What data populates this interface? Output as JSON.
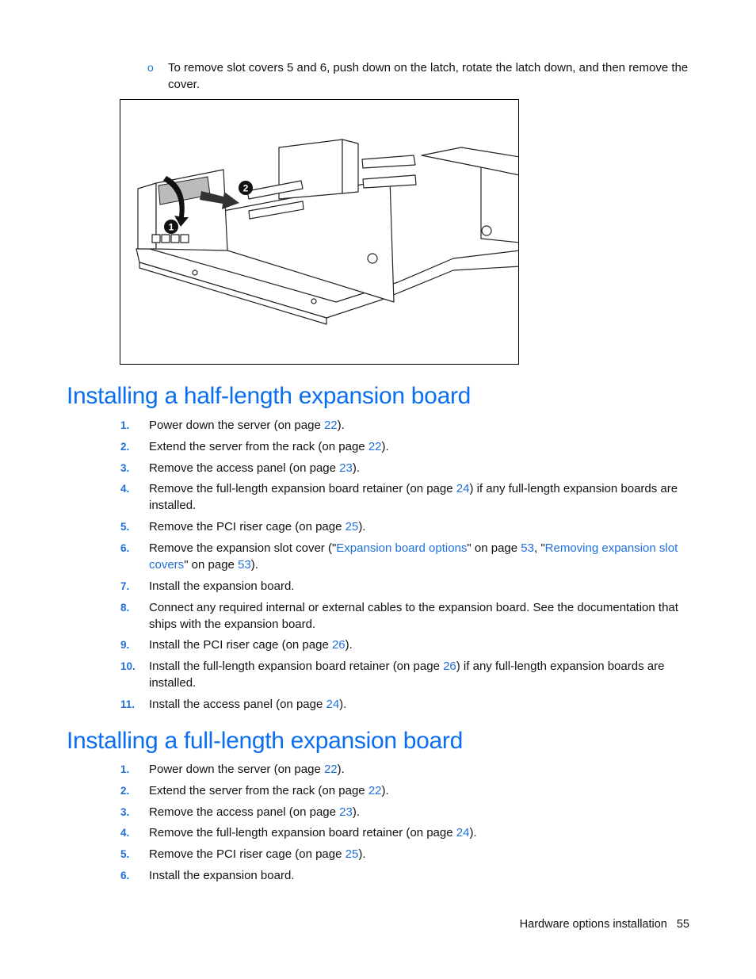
{
  "bullet": {
    "text": "To remove slot covers 5 and 6, push down on the latch, rotate the latch down, and then remove the cover."
  },
  "figure": {
    "callouts": [
      "1",
      "2"
    ],
    "description": "PCI riser cage with slot cover latch being rotated down (1) and cover removed (2)"
  },
  "section1": {
    "title": "Installing a half-length expansion board",
    "steps": [
      {
        "num": "1.",
        "parts": [
          {
            "t": "Power down the server (on page "
          },
          {
            "t": "22",
            "link": true
          },
          {
            "t": ")."
          }
        ]
      },
      {
        "num": "2.",
        "parts": [
          {
            "t": "Extend the server from the rack (on page "
          },
          {
            "t": "22",
            "link": true
          },
          {
            "t": ")."
          }
        ]
      },
      {
        "num": "3.",
        "parts": [
          {
            "t": "Remove the access panel (on page "
          },
          {
            "t": "23",
            "link": true
          },
          {
            "t": ")."
          }
        ]
      },
      {
        "num": "4.",
        "parts": [
          {
            "t": "Remove the full-length expansion board retainer (on page "
          },
          {
            "t": "24",
            "link": true
          },
          {
            "t": ") if any full-length expansion boards are installed."
          }
        ]
      },
      {
        "num": "5.",
        "parts": [
          {
            "t": "Remove the PCI riser cage (on page "
          },
          {
            "t": "25",
            "link": true
          },
          {
            "t": ")."
          }
        ]
      },
      {
        "num": "6.",
        "parts": [
          {
            "t": "Remove the expansion slot cover (\""
          },
          {
            "t": "Expansion board options",
            "link": true
          },
          {
            "t": "\" on page "
          },
          {
            "t": "53",
            "link": true
          },
          {
            "t": ", \""
          },
          {
            "t": "Removing expansion slot covers",
            "link": true
          },
          {
            "t": "\" on page "
          },
          {
            "t": "53",
            "link": true
          },
          {
            "t": ")."
          }
        ]
      },
      {
        "num": "7.",
        "parts": [
          {
            "t": "Install the expansion board."
          }
        ]
      },
      {
        "num": "8.",
        "parts": [
          {
            "t": "Connect any required internal or external cables to the expansion board. See the documentation that ships with the expansion board."
          }
        ]
      },
      {
        "num": "9.",
        "parts": [
          {
            "t": "Install the PCI riser cage (on page "
          },
          {
            "t": "26",
            "link": true
          },
          {
            "t": ")."
          }
        ]
      },
      {
        "num": "10.",
        "parts": [
          {
            "t": "Install the full-length expansion board retainer (on page "
          },
          {
            "t": "26",
            "link": true
          },
          {
            "t": ") if any full-length expansion boards are installed."
          }
        ]
      },
      {
        "num": "11.",
        "parts": [
          {
            "t": "Install the access panel (on page "
          },
          {
            "t": "24",
            "link": true
          },
          {
            "t": ")."
          }
        ]
      }
    ]
  },
  "section2": {
    "title": "Installing a full-length expansion board",
    "steps": [
      {
        "num": "1.",
        "parts": [
          {
            "t": "Power down the server (on page "
          },
          {
            "t": "22",
            "link": true
          },
          {
            "t": ")."
          }
        ]
      },
      {
        "num": "2.",
        "parts": [
          {
            "t": "Extend the server from the rack (on page "
          },
          {
            "t": "22",
            "link": true
          },
          {
            "t": ")."
          }
        ]
      },
      {
        "num": "3.",
        "parts": [
          {
            "t": "Remove the access panel (on page "
          },
          {
            "t": "23",
            "link": true
          },
          {
            "t": ")."
          }
        ]
      },
      {
        "num": "4.",
        "parts": [
          {
            "t": "Remove the full-length expansion board retainer (on page "
          },
          {
            "t": "24",
            "link": true
          },
          {
            "t": ")."
          }
        ]
      },
      {
        "num": "5.",
        "parts": [
          {
            "t": "Remove the PCI riser cage (on page "
          },
          {
            "t": "25",
            "link": true
          },
          {
            "t": ")."
          }
        ]
      },
      {
        "num": "6.",
        "parts": [
          {
            "t": "Install the expansion board."
          }
        ]
      }
    ]
  },
  "footer": {
    "section": "Hardware options installation",
    "page": "55"
  },
  "colors": {
    "heading": "#0a6ef0",
    "link": "#1f6fdc"
  }
}
